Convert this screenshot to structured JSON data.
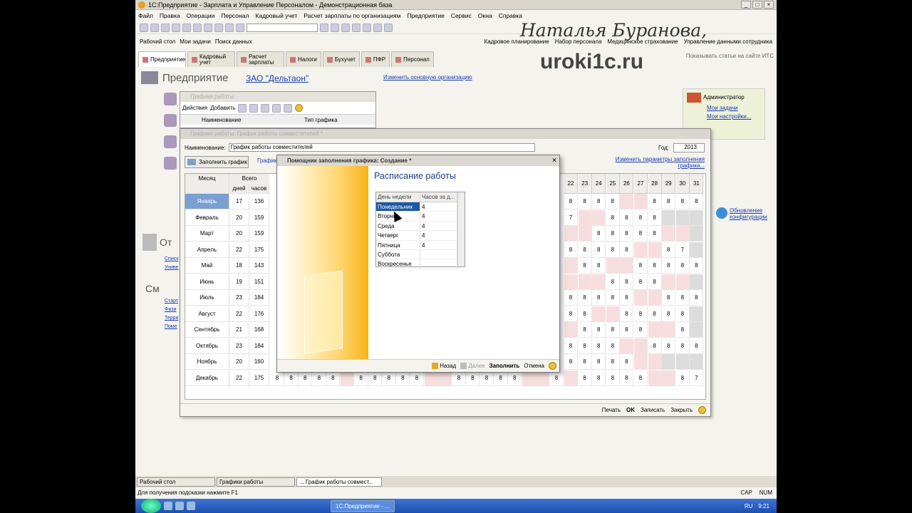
{
  "app": {
    "title": "1С:Предприятие - Зарплата и Управление Персоналом - Демонстрационная база",
    "menu": [
      "Файл",
      "Правка",
      "Операции",
      "Персонал",
      "Кадровый учет",
      "Расчет зарплаты по организациям",
      "Предприятие",
      "Сервис",
      "Окна",
      "Справка"
    ],
    "toolbar2": {
      "left": [
        "Рабочий стол",
        "Мои задачи",
        "Поиск данных"
      ],
      "right": [
        "Кадровое планирование",
        "Набор персонала",
        "Медицинское страхование",
        "Управление данными сотрудника"
      ]
    },
    "tabs": [
      "Предприятие",
      "Кадровый учет",
      "Расчет зарплаты",
      "Налоги",
      "Бухучет",
      "ПФР",
      "Персонал"
    ],
    "its_link": "Показывать статьи на сайте ИТС",
    "watermark_name": "Наталья Буранова,",
    "watermark_site": "uroki1c.ru"
  },
  "background": {
    "heading": "Предприятие",
    "org": "ЗАО \"Дельтаон\"",
    "change_org": "Изменить основную организацию",
    "section_ot": "От",
    "section_sm": "См",
    "links_ot": [
      "Списк",
      "Униве"
    ],
    "links_sm": [
      "Старт",
      "Физи",
      "Терри",
      "Поме"
    ],
    "admin": {
      "title": "Администратор",
      "tasks": "Мои задачи",
      "settings": "Мои настройки..."
    },
    "update": "Обновление конфигурации"
  },
  "list_window": {
    "title": "Графики работы",
    "actions": "Действия",
    "add": "Добавить",
    "col_name": "Наименование",
    "col_type": "Тип графика"
  },
  "schedule_window": {
    "title": "Графики работы: График работы совместителей *",
    "name_label": "Наименование:",
    "name_value": "График работы совместителей",
    "year_label": "Год:",
    "year_value": "2013",
    "fill_button": "Заполнить график",
    "grid_tab": "График",
    "change_params": "Изменить параметры заполнения графика...",
    "col_month": "Месяц",
    "col_total": "Всего",
    "col_days": "дней",
    "col_hours": "часов",
    "day_headers": [
      "22",
      "23",
      "24",
      "25",
      "26",
      "27",
      "28",
      "29",
      "30",
      "31"
    ],
    "months": [
      {
        "name": "Январь",
        "days": "17",
        "hours": "136"
      },
      {
        "name": "Февраль",
        "days": "20",
        "hours": "159"
      },
      {
        "name": "Март",
        "days": "20",
        "hours": "159"
      },
      {
        "name": "Апрель",
        "days": "22",
        "hours": "175"
      },
      {
        "name": "Май",
        "days": "18",
        "hours": "143"
      },
      {
        "name": "Июнь",
        "days": "19",
        "hours": "151"
      },
      {
        "name": "Июль",
        "days": "23",
        "hours": "184"
      },
      {
        "name": "Август",
        "days": "22",
        "hours": "176"
      },
      {
        "name": "Сентябрь",
        "days": "21",
        "hours": "168"
      },
      {
        "name": "Октябрь",
        "days": "23",
        "hours": "184"
      },
      {
        "name": "Ноябрь",
        "days": "20",
        "hours": "160"
      },
      {
        "name": "Декабрь",
        "days": "22",
        "hours": "175"
      }
    ],
    "right_cells": [
      [
        "8",
        "8",
        "8",
        "8",
        "p",
        "p",
        "8",
        "8",
        "8",
        "8"
      ],
      [
        "7",
        "p",
        "p",
        "8",
        "8",
        "8",
        "8",
        "g",
        "g",
        "g"
      ],
      [
        "p",
        "p",
        "8",
        "8",
        "8",
        "8",
        "8",
        "p",
        "p",
        "g"
      ],
      [
        "8",
        "8",
        "8",
        "8",
        "8",
        "p",
        "p",
        "8",
        "7",
        "g"
      ],
      [
        "p",
        "8",
        "8",
        "p",
        "p",
        "8",
        "8",
        "8",
        "8",
        "8"
      ],
      [
        "p",
        "p",
        "p",
        "8",
        "8",
        "8",
        "8",
        "p",
        "p",
        "g"
      ],
      [
        "8",
        "8",
        "8",
        "8",
        "8",
        "p",
        "p",
        "8",
        "8",
        "8"
      ],
      [
        "8",
        "8",
        "p",
        "p",
        "8",
        "8",
        "8",
        "8",
        "8",
        "g"
      ],
      [
        "p",
        "8",
        "8",
        "8",
        "8",
        "8",
        "p",
        "p",
        "8",
        "g"
      ],
      [
        "8",
        "8",
        "8",
        "8",
        "p",
        "p",
        "8",
        "8",
        "8",
        "8"
      ],
      [
        "8",
        "8",
        "8",
        "8",
        "8",
        "p",
        "p",
        "g",
        "g",
        "g"
      ],
      [
        "p",
        "8",
        "8",
        "8",
        "8",
        "8",
        "p",
        "p",
        "8",
        "7"
      ]
    ],
    "dec_left": [
      "8",
      "8",
      "8",
      "8",
      "8",
      "p",
      "8",
      "8",
      "8",
      "8",
      "8",
      "p",
      "p",
      "8",
      "8",
      "8",
      "8",
      "8",
      "p",
      "p",
      "8"
    ],
    "footer": [
      "Печать",
      "OK",
      "Записать",
      "Закрыть"
    ]
  },
  "wizard": {
    "title": "Помощник заполнения графика: Создание *",
    "heading": "Расписание работы",
    "col_day": "День недели",
    "col_hours": "Часов за д...",
    "rows": [
      {
        "day": "Понедельник",
        "hours": "4"
      },
      {
        "day": "Вторник",
        "hours": "4"
      },
      {
        "day": "Среда",
        "hours": "4"
      },
      {
        "day": "Четверг",
        "hours": "4"
      },
      {
        "day": "Пятница",
        "hours": "4"
      },
      {
        "day": "Суббота",
        "hours": ""
      },
      {
        "day": "Воскресенье",
        "hours": ""
      }
    ],
    "back": "Назад",
    "next": "Далее",
    "fill": "Заполнить",
    "cancel": "Отмена"
  },
  "window_bar": [
    "Рабочий стол",
    "Графики работы",
    "... График работы совмест..."
  ],
  "status": {
    "hint": "Для получения подсказки нажмите F1",
    "cap": "CAP",
    "num": "NUM"
  },
  "taskbar": {
    "item": "1С:Предприятие - ...",
    "lang": "RU",
    "time": "9:21"
  }
}
